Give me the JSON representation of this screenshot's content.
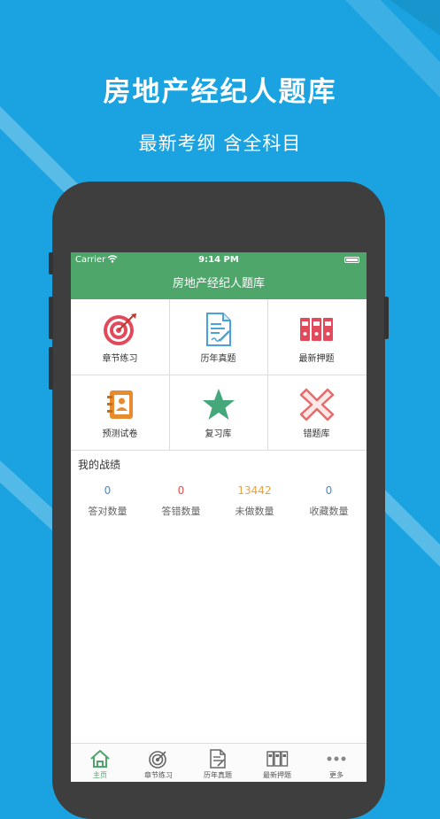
{
  "promo": {
    "title": "房地产经纪人题库",
    "subtitle": "最新考纲 含全科目"
  },
  "status_bar": {
    "carrier": "Carrier",
    "time": "9:14 PM"
  },
  "nav": {
    "title": "房地产经纪人题库"
  },
  "menu": [
    {
      "label": "章节练习",
      "icon": "target-icon"
    },
    {
      "label": "历年真题",
      "icon": "document-edit-icon"
    },
    {
      "label": "最新押题",
      "icon": "binders-icon"
    },
    {
      "label": "预测试卷",
      "icon": "contact-book-icon"
    },
    {
      "label": "复习库",
      "icon": "star-icon"
    },
    {
      "label": "错题库",
      "icon": "cross-icon"
    }
  ],
  "stats": {
    "title": "我的战绩",
    "items": [
      {
        "value": "0",
        "label": "答对数量",
        "color": "#3b8fd6"
      },
      {
        "value": "0",
        "label": "答错数量",
        "color": "#e2504a"
      },
      {
        "value": "13442",
        "label": "未做数量",
        "color": "#e9a23b"
      },
      {
        "value": "0",
        "label": "收藏数量",
        "color": "#3b8fd6"
      }
    ]
  },
  "tabbar": [
    {
      "label": "主页",
      "icon": "home-icon",
      "active": true
    },
    {
      "label": "章节练习",
      "icon": "target-icon",
      "active": false
    },
    {
      "label": "历年真题",
      "icon": "document-icon",
      "active": false
    },
    {
      "label": "最新押题",
      "icon": "binders-icon",
      "active": false
    },
    {
      "label": "更多",
      "icon": "more-icon",
      "active": false
    }
  ],
  "colors": {
    "background": "#1aa3e0",
    "accent_green": "#4ea66b"
  }
}
